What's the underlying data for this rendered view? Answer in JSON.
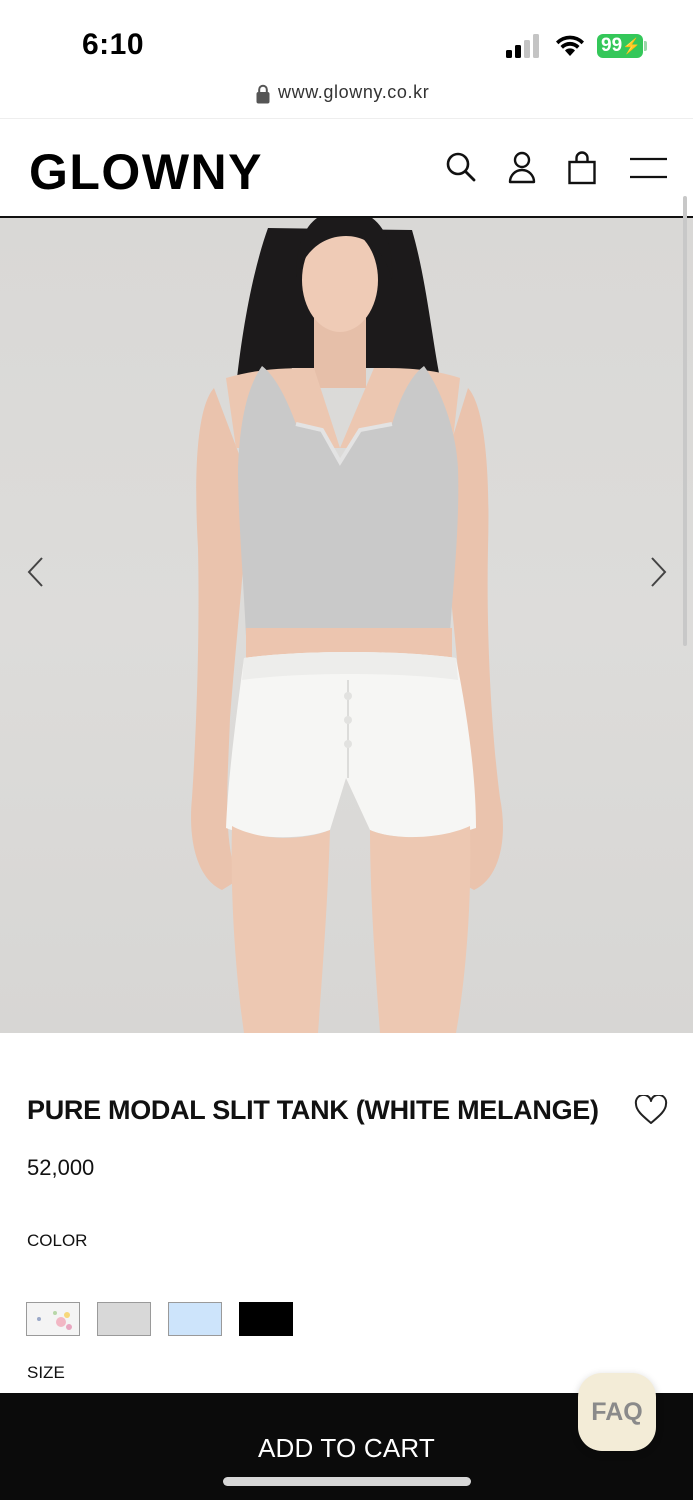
{
  "status_bar": {
    "time": "6:10",
    "battery": "99"
  },
  "url_bar": {
    "url": "www.glowny.co.kr"
  },
  "header": {
    "logo": "GLOWNY",
    "icons": [
      "search-icon",
      "account-icon",
      "shopping-bag-icon",
      "menu-icon"
    ]
  },
  "gallery": {
    "image_alt": "Model wearing grey slit tank top and white shorts",
    "prev_icon": "chevron-left-icon",
    "next_icon": "chevron-right-icon"
  },
  "product": {
    "title": "PURE MODAL SLIT TANK (WHITE MELANGE)",
    "price": "52,000",
    "color_label": "COLOR",
    "size_label": "SIZE",
    "swatches": [
      {
        "name": "pattern",
        "color": "#f4f4f4"
      },
      {
        "name": "grey",
        "color": "#d8d8d8"
      },
      {
        "name": "light-blue",
        "color": "#cde4fb"
      },
      {
        "name": "black",
        "color": "#000000"
      }
    ]
  },
  "footer": {
    "add_to_cart": "ADD TO CART",
    "faq": "FAQ"
  },
  "colors": {
    "battery_green": "#34c759",
    "cart_bar": "#0b0b0b",
    "faq_bg": "#f3ecd7",
    "image_bg": "#dbdad8"
  }
}
